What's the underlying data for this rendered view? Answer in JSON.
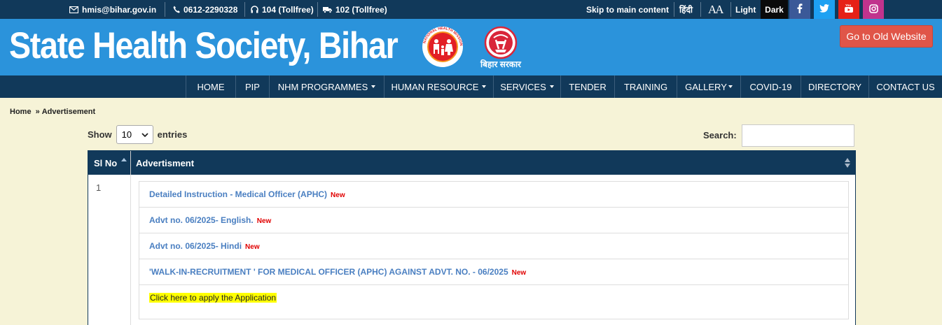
{
  "topbar": {
    "email": "hmis@bihar.gov.in",
    "phone": "0612-2290328",
    "helpline": "104 (Tollfree)",
    "ambulance": "102 (Tollfree)",
    "skip": "Skip to main content",
    "hindi": "हिंदी",
    "font_size": "AA",
    "light": "Light",
    "dark": "Dark",
    "social": [
      "facebook-icon",
      "twitter-icon",
      "youtube-icon",
      "instagram-icon"
    ],
    "social_colors": [
      "#3b5998",
      "#1da1f2",
      "#e62117",
      "#c1338d"
    ]
  },
  "header": {
    "title": "State Health Society, Bihar",
    "nhm_logo_text": "NATIONAL HEALTH MISSION",
    "bihar_logo_text": "बिहार सरकार",
    "old_website_button": "Go to Old Website"
  },
  "nav": {
    "items": [
      {
        "label": "HOME",
        "dropdown": false
      },
      {
        "label": "PIP",
        "dropdown": false
      },
      {
        "label": "NHM PROGRAMMES",
        "dropdown": true
      },
      {
        "label": "HUMAN RESOURCE",
        "dropdown": true
      },
      {
        "label": "SERVICES",
        "dropdown": true
      },
      {
        "label": "TENDER",
        "dropdown": false
      },
      {
        "label": "TRAINING",
        "dropdown": false
      },
      {
        "label": "GALLERY",
        "dropdown": true
      },
      {
        "label": "COVID-19",
        "dropdown": false
      },
      {
        "label": "DIRECTORY",
        "dropdown": false
      },
      {
        "label": "CONTACT US",
        "dropdown": false
      }
    ]
  },
  "breadcrumb": {
    "home": "Home",
    "separator": "»",
    "current": "Advertisement"
  },
  "controls": {
    "show_label": "Show",
    "entries_value": "10",
    "entries_label": "entries",
    "search_label": "Search:",
    "search_value": ""
  },
  "table": {
    "columns": [
      "Sl No",
      "Advertisment"
    ],
    "rows": [
      {
        "sl_no": "1",
        "items": [
          {
            "text": "Detailed Instruction - Medical Officer (APHC)",
            "badge": "New"
          },
          {
            "text": "Advt no. 06/2025- English.",
            "badge": "New"
          },
          {
            "text": "Advt no. 06/2025- Hindi",
            "badge": "New"
          },
          {
            "text": "'WALK-IN-RECRUITMENT ' FOR MEDICAL OFFICER (APHC) AGAINST ADVT. NO. - 06/2025",
            "badge": "New"
          },
          {
            "text": "Click here to apply the Application",
            "badge": ""
          }
        ]
      }
    ]
  },
  "colors": {
    "topbar_bg": "#11395a",
    "header_bg": "#2b93db",
    "page_bg": "#f6f3d7",
    "link": "#4a7fc1",
    "new_badge": "#e10000",
    "old_button": "#e05548",
    "highlight": "#ffff00"
  }
}
